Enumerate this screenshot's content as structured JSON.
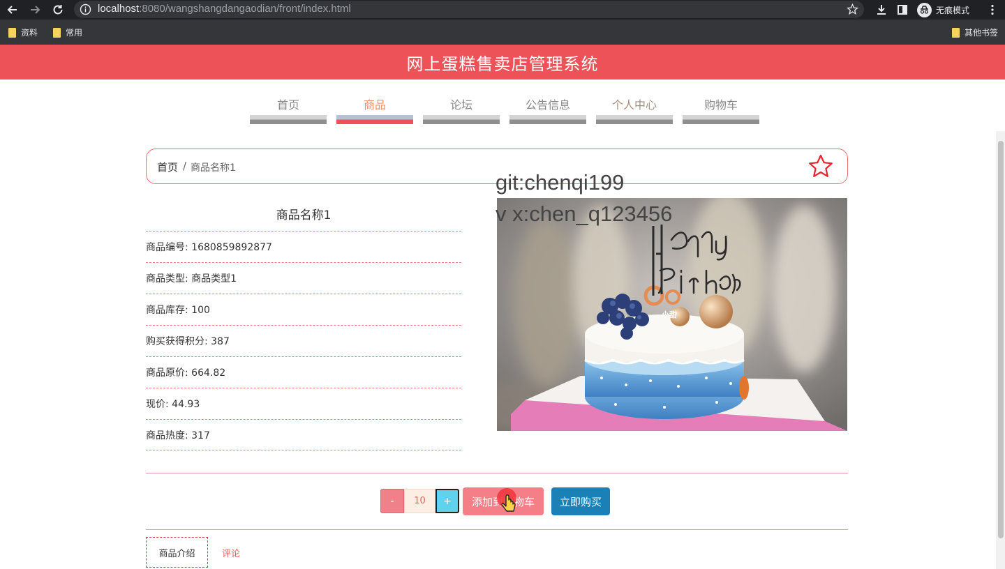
{
  "browser": {
    "url_host": "localhost",
    "url_rest": ":8080/wangshangdangaodian/front/index.html",
    "profile_label": "无痕模式",
    "bookmarks": [
      "资料",
      "常用"
    ],
    "other_bookmarks": "其他书签"
  },
  "header": {
    "title": "网上蛋糕售卖店管理系统"
  },
  "nav": {
    "items": [
      {
        "label": "首页"
      },
      {
        "label": "商品"
      },
      {
        "label": "论坛"
      },
      {
        "label": "公告信息"
      },
      {
        "label": "个人中心"
      },
      {
        "label": "购物车"
      }
    ],
    "active": "商品"
  },
  "breadcrumb": {
    "home": "首页",
    "separator": "/",
    "current": "商品名称1"
  },
  "watermark": {
    "line1": "git:chenqi199",
    "line2": "v x:chen_q123456"
  },
  "product": {
    "name": "商品名称1",
    "details": [
      "商品编号: 1680859892877",
      "商品类型: 商品类型1",
      "商品库存: 100",
      "购买获得积分: 387",
      "商品原价: 664.82",
      "现价: 44.93",
      "商品热度: 317"
    ],
    "image_text": "小甜"
  },
  "actions": {
    "minus": "-",
    "quantity": "10",
    "plus": "+",
    "add_to_cart": "添加到购物车",
    "buy_now": "立即购买"
  },
  "tabs": {
    "intro": "商品介绍",
    "comments": "评论"
  },
  "colors": {
    "brand": "#ec5258",
    "buy": "#1a80b6",
    "add_cart": "#f47f87"
  }
}
